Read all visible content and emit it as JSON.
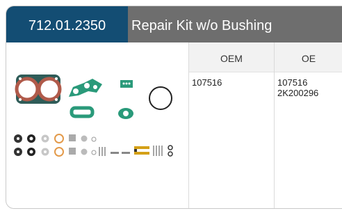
{
  "product": {
    "part_number": "712.01.2350",
    "title": "Repair Kit w/o Bushing"
  },
  "table": {
    "headers": [
      "OEM",
      "OE"
    ],
    "rows": [
      {
        "oem": [
          "107516"
        ],
        "oe": [
          "107516",
          "2K200296"
        ]
      }
    ]
  },
  "image": {
    "icons": [
      "gasket-icon",
      "o-ring-icon",
      "washer-icon",
      "spring-icon",
      "bolt-icon"
    ],
    "colors": {
      "gasket": "#b05a4a",
      "seal": "#2a9a7a",
      "header_accent": "#134d73",
      "header_bg": "#6e6e6e"
    }
  }
}
